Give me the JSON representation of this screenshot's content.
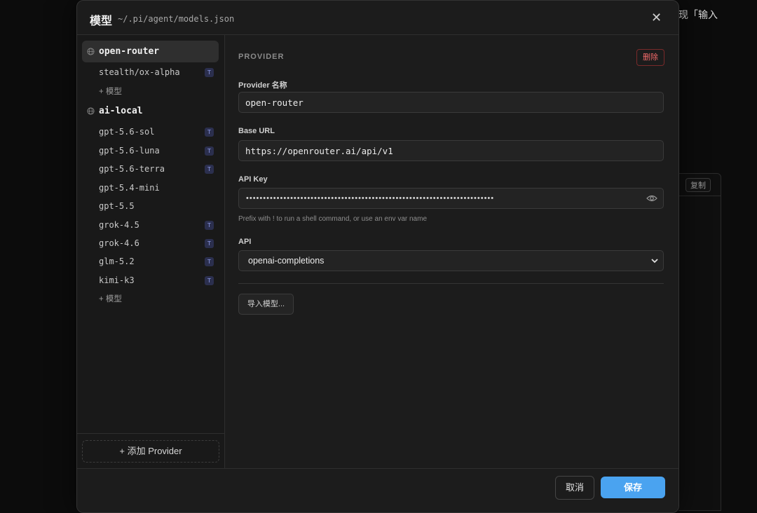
{
  "background": {
    "hint_text": "现「输入",
    "copy_label": "复制"
  },
  "modal": {
    "title": "模型",
    "path": "~/.pi/agent/models.json",
    "close_glyph": "✕"
  },
  "sidebar": {
    "providers": [
      {
        "name": "open-router",
        "selected": true,
        "models": [
          {
            "name": "stealth/ox-alpha",
            "badge": "T"
          }
        ],
        "add_model_label": "+ 模型"
      },
      {
        "name": "ai-local",
        "selected": false,
        "models": [
          {
            "name": "gpt-5.6-sol",
            "badge": "T"
          },
          {
            "name": "gpt-5.6-luna",
            "badge": "T"
          },
          {
            "name": "gpt-5.6-terra",
            "badge": "T"
          },
          {
            "name": "gpt-5.4-mini",
            "badge": ""
          },
          {
            "name": "gpt-5.5",
            "badge": ""
          },
          {
            "name": "grok-4.5",
            "badge": "T"
          },
          {
            "name": "grok-4.6",
            "badge": "T"
          },
          {
            "name": "glm-5.2",
            "badge": "T"
          },
          {
            "name": "kimi-k3",
            "badge": "T"
          }
        ],
        "add_model_label": "+ 模型"
      }
    ],
    "add_provider_label": "+ 添加 Provider"
  },
  "form": {
    "section_title": "PROVIDER",
    "delete_label": "删除",
    "provider_name": {
      "label": "Provider 名称",
      "value": "open-router"
    },
    "base_url": {
      "label": "Base URL",
      "value": "https://openrouter.ai/api/v1"
    },
    "api_key": {
      "label": "API Key",
      "masked_value": "•••••••••••••••••••••••••••••••••••••••••••••••••••••••••••••••••••••••••",
      "hint": "Prefix with ! to run a shell command, or use an env var name"
    },
    "api": {
      "label": "API",
      "selected": "openai-completions"
    },
    "import_label": "导入模型..."
  },
  "footer": {
    "cancel_label": "取消",
    "save_label": "保存"
  },
  "colors": {
    "accent": "#4aa3f0",
    "danger": "#f06a6a",
    "badge_bg": "#2b2f4e"
  },
  "icons": [
    "globe-icon",
    "close-icon",
    "eye-icon",
    "chevron-down-icon"
  ]
}
